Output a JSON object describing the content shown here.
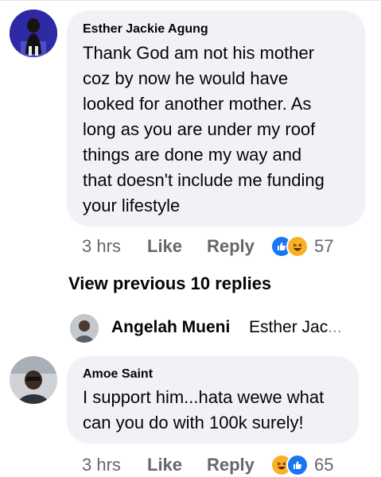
{
  "comments": [
    {
      "author": "Esther Jackie Agung",
      "text": "Thank God am not his mother\ncoz by now he would have\nlooked for another mother. As\nlong as you are under my roof\nthings are done my way and\nthat doesn't include me funding\nyour lifestyle",
      "time": "3 hrs",
      "like_label": "Like",
      "reply_label": "Reply",
      "reactions": [
        "like-icon",
        "haha-icon"
      ],
      "reaction_count": "57"
    },
    {
      "author": "Amoe Saint",
      "text": "I support him...hata wewe what\ncan you do with 100k surely!",
      "time": "3 hrs",
      "like_label": "Like",
      "reply_label": "Reply",
      "reactions": [
        "haha-icon",
        "like-icon"
      ],
      "reaction_count": "65"
    }
  ],
  "view_previous_label": "View previous 10 replies",
  "reply_preview": {
    "name": "Angelah Mueni",
    "snippet": "Esther Jac",
    "ellipsis": "..."
  },
  "colors": {
    "bubble": "#f0f2f5",
    "meta_text": "#65676b",
    "like_blue": "#1877f2",
    "haha_yellow": "#f7b125"
  }
}
